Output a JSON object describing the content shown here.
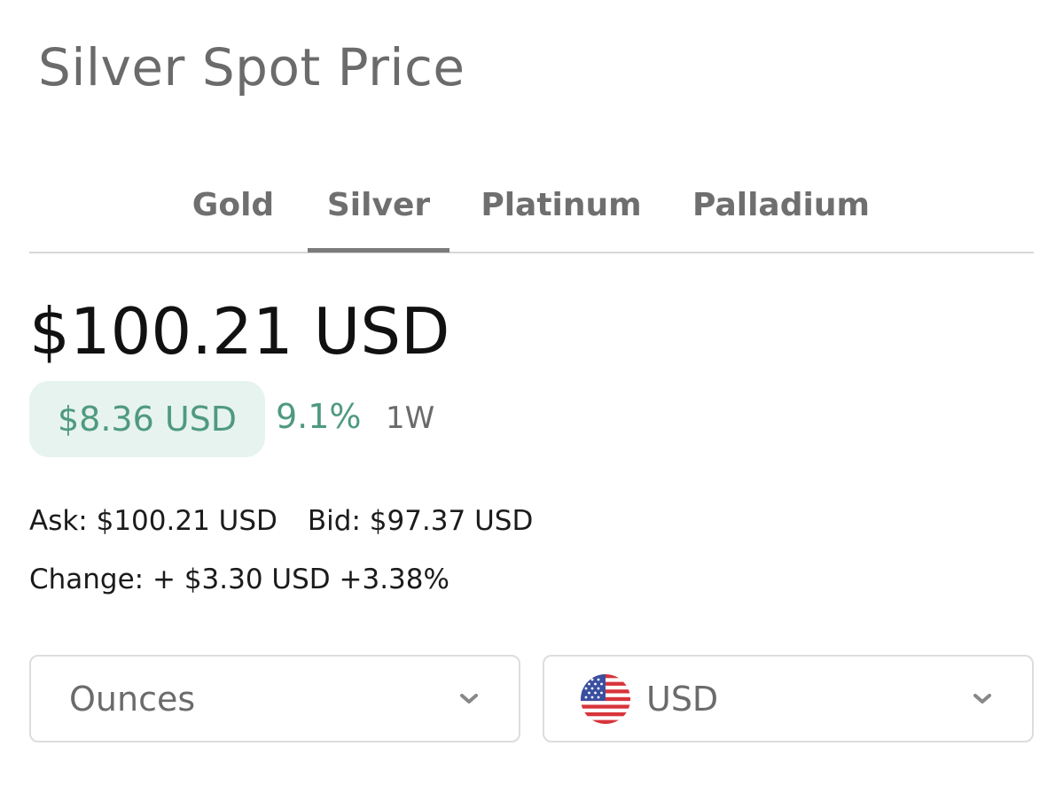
{
  "header": {
    "title": "Silver Spot Price"
  },
  "tabs": [
    {
      "label": "Gold",
      "active": false
    },
    {
      "label": "Silver",
      "active": true
    },
    {
      "label": "Platinum",
      "active": false
    },
    {
      "label": "Palladium",
      "active": false
    }
  ],
  "quote": {
    "price": "$100.21 USD",
    "change_amount": "$8.36 USD",
    "change_percent": "9.1%",
    "period": "1W",
    "ask": "Ask: $100.21 USD",
    "bid": "Bid: $97.37 USD",
    "change_line": "Change: + $3.30 USD +3.38%"
  },
  "selectors": {
    "units": {
      "value": "Ounces",
      "icon": "chevron-down-icon"
    },
    "currency": {
      "value": "USD",
      "icon": "us-flag-icon"
    }
  },
  "colors": {
    "positive": "#4f9a7f",
    "positive_bg": "#e7f3ef",
    "tab_text": "#6f6f6f",
    "title_text": "#6b6b6b",
    "price_text": "#111111"
  }
}
